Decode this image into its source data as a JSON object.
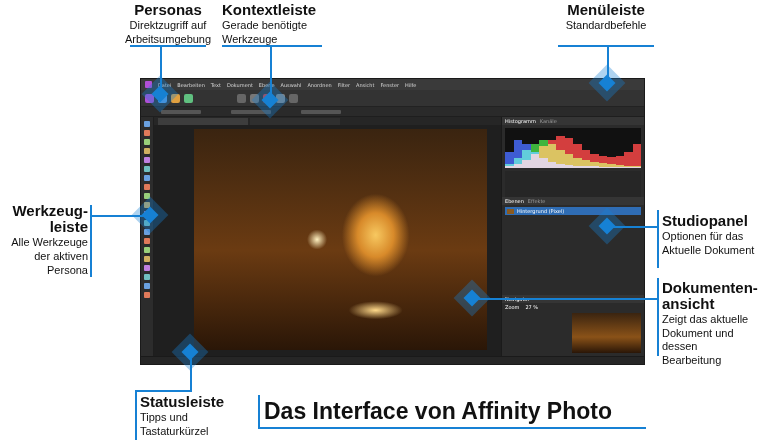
{
  "title": "Das Interface von Affinity Photo",
  "callouts": [
    {
      "title": [
        "Personas"
      ],
      "text": [
        "Direktzugriff auf",
        "Arbeitsumgebung"
      ]
    },
    {
      "title": [
        "Kontextleiste"
      ],
      "text": [
        "Gerade benötigte",
        "Werkzeuge"
      ]
    },
    {
      "title": [
        "Menüleiste"
      ],
      "text": [
        "Standardbefehle"
      ]
    },
    {
      "title": [
        "Werkzeug-",
        "leiste"
      ],
      "text": [
        "Alle Werkzeuge",
        "der aktiven",
        "Persona"
      ]
    },
    {
      "title": [
        "Studiopanel"
      ],
      "text": [
        "Optionen für das",
        "Aktuelle Dokument"
      ]
    },
    {
      "title": [
        "Dokumenten-",
        "ansicht"
      ],
      "text": [
        "Zeigt das aktuelle",
        "Dokument und dessen",
        "Bearbeitung"
      ]
    },
    {
      "title": [
        "Statusleiste"
      ],
      "text": [
        "Tipps und",
        "Tastaturkürzel"
      ]
    }
  ],
  "app": {
    "menu": [
      "Datei",
      "Bearbeiten",
      "Text",
      "Dokument",
      "Ebene",
      "Auswahl",
      "Anordnen",
      "Filter",
      "Ansicht",
      "Fenster",
      "Hilfe"
    ],
    "panel_tabs": [
      {
        "label": "Histogramm",
        "selected": true
      },
      {
        "label": "Kanäle",
        "selected": false
      }
    ],
    "layer_tabs": [
      {
        "label": "Ebenen",
        "selected": true
      },
      {
        "label": "Effekte",
        "selected": false
      }
    ],
    "layers": [
      {
        "name": "Hintergrund (Pixel)",
        "selected": true
      }
    ],
    "navigator": {
      "label": "Navigator",
      "zoom_label": "Zoom",
      "zoom": "27 %"
    },
    "histogram": {
      "red": [
        5,
        10,
        20,
        35,
        55,
        70,
        80,
        75,
        60,
        45,
        35,
        30,
        28,
        30,
        40,
        60
      ],
      "green": [
        10,
        25,
        45,
        60,
        70,
        60,
        45,
        35,
        25,
        20,
        15,
        12,
        10,
        8,
        6,
        5
      ],
      "blue": [
        40,
        70,
        60,
        40,
        25,
        15,
        10,
        8,
        6,
        5,
        4,
        3,
        3,
        2,
        2,
        2
      ]
    }
  }
}
